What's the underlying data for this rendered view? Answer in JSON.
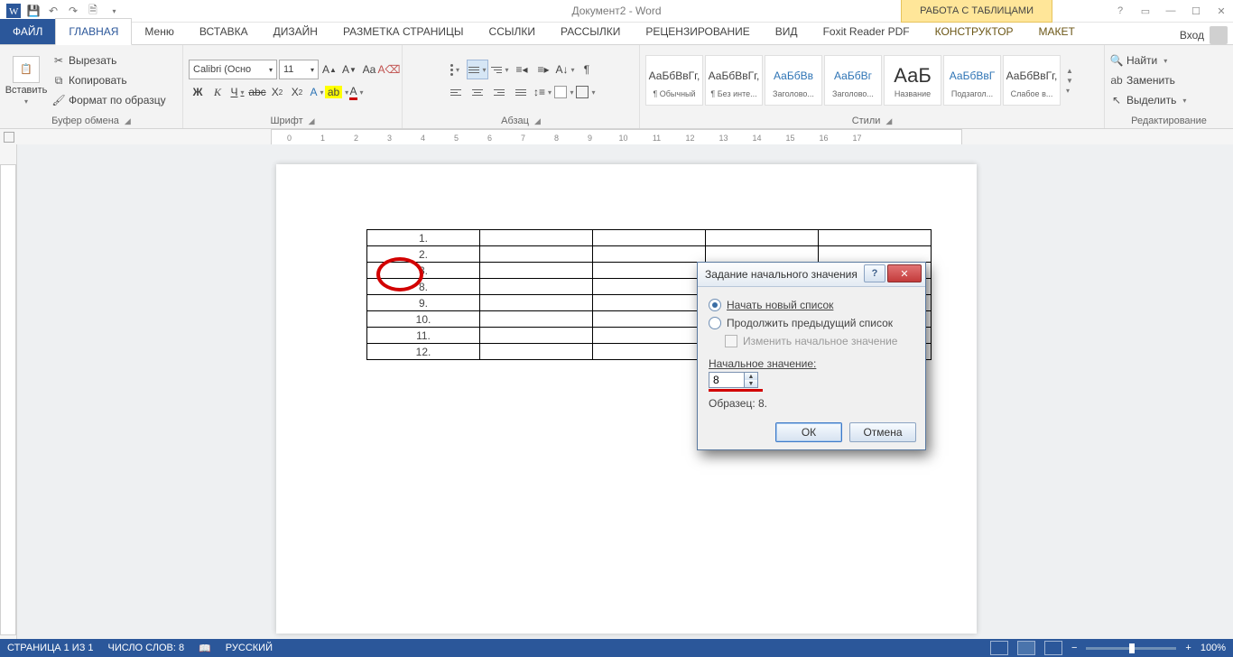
{
  "title": "Документ2 - Word",
  "table_tools": "РАБОТА С ТАБЛИЦАМИ",
  "signin": "Вход",
  "tabs": [
    "ФАЙЛ",
    "ГЛАВНАЯ",
    "Меню",
    "ВСТАВКА",
    "ДИЗАЙН",
    "РАЗМЕТКА СТРАНИЦЫ",
    "ССЫЛКИ",
    "РАССЫЛКИ",
    "РЕЦЕНЗИРОВАНИЕ",
    "ВИД",
    "Foxit Reader PDF",
    "КОНСТРУКТОР",
    "МАКЕТ"
  ],
  "clipboard": {
    "paste": "Вставить",
    "cut": "Вырезать",
    "copy": "Копировать",
    "format": "Формат по образцу",
    "group": "Буфер обмена"
  },
  "font": {
    "name": "Calibri (Осно",
    "size": "11",
    "group": "Шрифт"
  },
  "paragraph": {
    "group": "Абзац"
  },
  "styles": {
    "group": "Стили",
    "items": [
      {
        "preview": "АаБбВвГг,",
        "label": "¶ Обычный"
      },
      {
        "preview": "АаБбВвГг,",
        "label": "¶ Без инте..."
      },
      {
        "preview": "АаБбВв",
        "label": "Заголово...",
        "cls": "h1"
      },
      {
        "preview": "АаБбВг",
        "label": "Заголово...",
        "cls": "h1"
      },
      {
        "preview": "АаБ",
        "label": "Название",
        "cls": "big"
      },
      {
        "preview": "АаБбВвГ",
        "label": "Подзагол...",
        "cls": "h1"
      },
      {
        "preview": "АаБбВвГг,",
        "label": "Слабое в..."
      }
    ]
  },
  "editing": {
    "find": "Найти",
    "replace": "Заменить",
    "select": "Выделить",
    "group": "Редактирование"
  },
  "table_numbers": [
    "1.",
    "2.",
    "3.",
    "8.",
    "9.",
    "10.",
    "11.",
    "12."
  ],
  "dialog": {
    "title": "Задание начального значения",
    "opt1": "Начать новый список",
    "opt2": "Продолжить предыдущий список",
    "chk": "Изменить начальное значение",
    "label": "Начальное значение:",
    "value": "8",
    "sample": "Образец: 8.",
    "ok": "ОК",
    "cancel": "Отмена"
  },
  "status": {
    "page": "СТРАНИЦА 1 ИЗ 1",
    "words": "ЧИСЛО СЛОВ: 8",
    "lang": "РУССКИЙ",
    "zoom": "100%"
  }
}
